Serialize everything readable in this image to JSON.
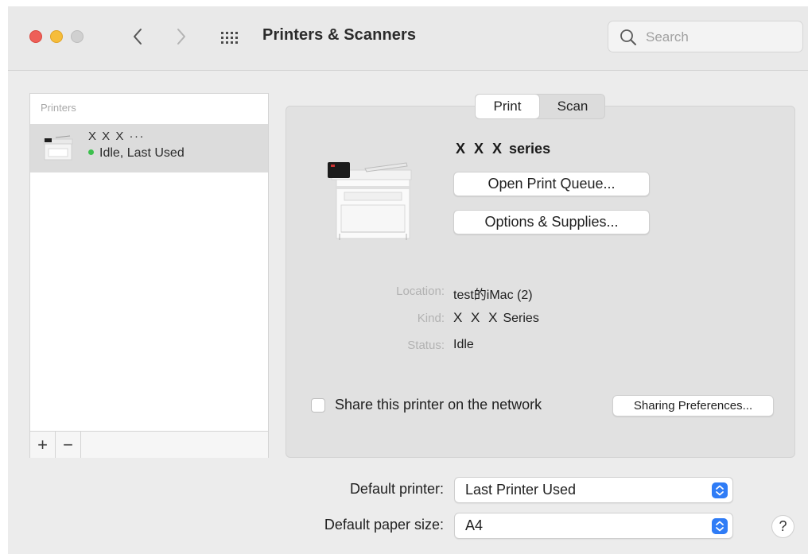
{
  "window": {
    "title": "Printers & Scanners",
    "search_placeholder": "Search"
  },
  "printers_list": {
    "header": "Printers",
    "items": [
      {
        "name": "X X X  ···",
        "status": "Idle, Last Used",
        "status_color": "#3cc04d"
      }
    ],
    "footer": {
      "add_label": "+",
      "remove_label": "−"
    }
  },
  "detail": {
    "tabs": [
      {
        "label": "Print",
        "selected": true
      },
      {
        "label": "Scan",
        "selected": false
      }
    ],
    "printer_name_prefix": "X X X",
    "printer_name_suffix": "series",
    "open_queue_label": "Open Print Queue...",
    "options_label": "Options & Supplies...",
    "location_label": "Location:",
    "location_value": "test的iMac (2)",
    "kind_label": "Kind:",
    "kind_prefix": "X X X",
    "kind_suffix": "Series",
    "status_label": "Status:",
    "status_value": "Idle",
    "share_label": "Share this printer on the network",
    "share_checked": false,
    "sharing_prefs_label": "Sharing Preferences..."
  },
  "defaults": {
    "printer_label": "Default printer:",
    "printer_value": "Last Printer Used",
    "paper_label": "Default paper size:",
    "paper_value": "A4"
  },
  "help_label": "?",
  "colors": {
    "close": "#ee5f58",
    "minimize": "#f6bd3a",
    "zoom_disabled": "#d0d0d0",
    "accent": "#2f7cf6"
  },
  "icons": [
    "back-chevron-icon",
    "forward-chevron-icon",
    "grid-icon",
    "search-icon",
    "printer-icon",
    "popup-arrows-icon"
  ]
}
